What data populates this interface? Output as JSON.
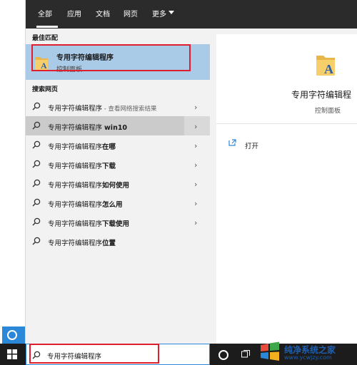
{
  "tabs": [
    {
      "label": "全部"
    },
    {
      "label": "应用"
    },
    {
      "label": "文档"
    },
    {
      "label": "网页"
    },
    {
      "label": "更多"
    }
  ],
  "best_match": {
    "section_title": "最佳匹配",
    "title": "专用字符编辑程序",
    "subtitle": "控制面板"
  },
  "web_search": {
    "section_title": "搜索网页",
    "results": [
      {
        "base": "专用字符编辑程序",
        "bold": "",
        "suffix": " - 查看网络搜索结果"
      },
      {
        "base": "专用字符编辑程序 ",
        "bold": "win10",
        "suffix": ""
      },
      {
        "base": "专用字符编辑程序",
        "bold": "在哪",
        "suffix": ""
      },
      {
        "base": "专用字符编辑程序",
        "bold": "下载",
        "suffix": ""
      },
      {
        "base": "专用字符编辑程序",
        "bold": "如何使用",
        "suffix": ""
      },
      {
        "base": "专用字符编辑程序",
        "bold": "怎么用",
        "suffix": ""
      },
      {
        "base": "专用字符编辑程序",
        "bold": "下载使用",
        "suffix": ""
      },
      {
        "base": "专用字符编辑程序",
        "bold": "位置",
        "suffix": ""
      }
    ]
  },
  "preview": {
    "title": "专用字符编辑程",
    "subtitle": "控制面板",
    "action_open": "打开"
  },
  "taskbar": {
    "search_value": "专用字符编辑程序"
  },
  "watermark": {
    "text": "纯净系统之家",
    "url": "www.ycwjzy.com"
  },
  "colors": {
    "accent": "#2b88d8",
    "highlight_red": "#e01e2d",
    "selected_bg": "#aacbe8"
  }
}
